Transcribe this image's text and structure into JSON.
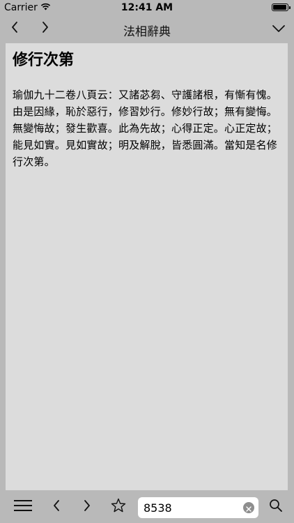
{
  "status_bar": {
    "carrier": "Carrier",
    "time": "12:41 AM",
    "wifi_icon": "wifi-icon",
    "battery_icon": "battery-icon"
  },
  "nav": {
    "title": "法相辭典",
    "back_icon": "chevron-left-icon",
    "forward_icon": "chevron-right-icon",
    "dropdown_icon": "chevron-down-icon"
  },
  "entry": {
    "title": "修行次第",
    "body": "瑜伽九十二卷八頁云：又諸苾芻、守護諸根，有慚有愧。由是因緣，恥於惡行，修習妙行。修妙行故；無有變悔。無變悔故；發生歡喜。此為先故；心得正定。心正定故；能見如實。見如實故；明及解脫，皆悉圓滿。當知是名修行次第。"
  },
  "toolbar": {
    "menu_icon": "menu-icon",
    "prev_icon": "chevron-left-icon",
    "next_icon": "chevron-right-icon",
    "bookmark_icon": "star-icon",
    "search_value": "8538",
    "clear_icon": "clear-icon",
    "search_icon": "search-icon"
  },
  "colors": {
    "chrome_background": "#b9b9b9",
    "content_background": "#dcdcdc",
    "text": "#000000"
  }
}
